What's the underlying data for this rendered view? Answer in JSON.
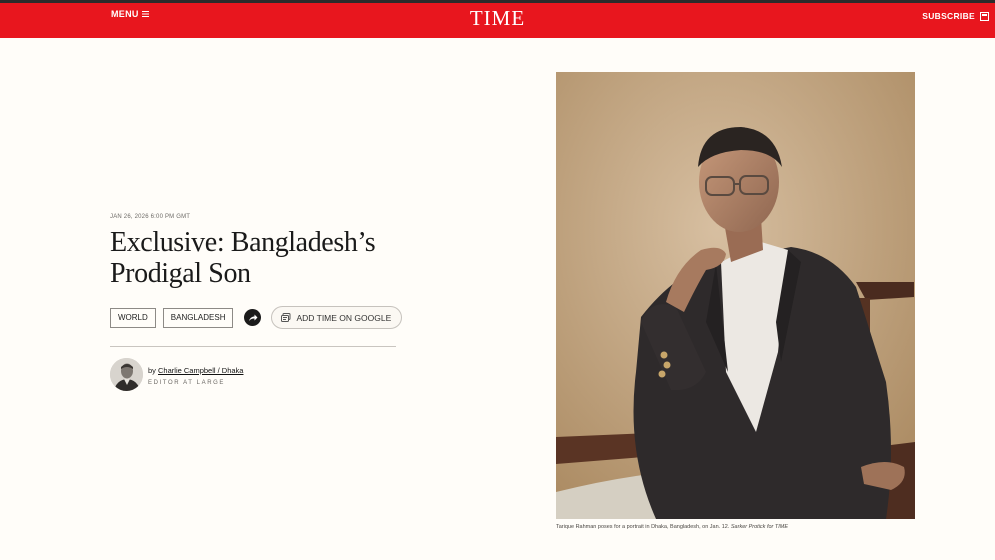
{
  "header": {
    "menu_label": "MENU",
    "logo": "TIME",
    "subscribe_label": "SUBSCRIBE",
    "brand_color": "#e8161e"
  },
  "article": {
    "date": "JAN 26, 2026 6:00 PM GMT",
    "title_line1": "Exclusive: Bangladesh’s",
    "title_line2": "Prodigal Son",
    "tags": [
      "WORLD",
      "BANGLADESH"
    ],
    "google_button_label": "ADD TIME ON GOOGLE",
    "byline_prefix": "by",
    "author": "Charlie Campbell / Dhaka",
    "author_title": "EDITOR AT LARGE"
  },
  "photo": {
    "caption": "Tarique Rahman poses for a portrait in Dhaka, Bangladesh, on Jan. 12.",
    "credit": "Sarker Protick for TIME"
  },
  "icons": {
    "menu": "hamburger-icon",
    "subscribe": "magazine-icon",
    "share": "share-icon",
    "google": "google-news-icon"
  }
}
